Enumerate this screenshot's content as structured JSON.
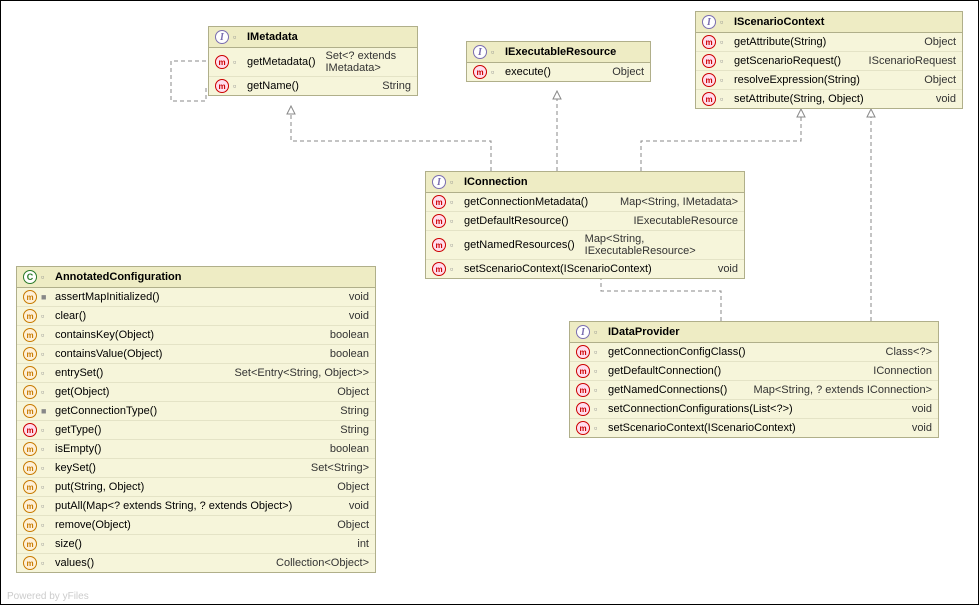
{
  "footer": "Powered by yFiles",
  "classes": {
    "imetadata": {
      "name": "IMetadata",
      "type": "interface",
      "methods": [
        {
          "k": "abs",
          "sig": "getMetadata()",
          "ret": "Set<? extends IMetadata>"
        },
        {
          "k": "abs",
          "sig": "getName()",
          "ret": "String"
        }
      ]
    },
    "iexecutableresource": {
      "name": "IExecutableResource",
      "type": "interface",
      "methods": [
        {
          "k": "abs",
          "sig": "execute()",
          "ret": "Object"
        }
      ]
    },
    "iscenariocontext": {
      "name": "IScenarioContext",
      "type": "interface",
      "methods": [
        {
          "k": "abs",
          "sig": "getAttribute(String)",
          "ret": "Object"
        },
        {
          "k": "abs",
          "sig": "getScenarioRequest()",
          "ret": "IScenarioRequest"
        },
        {
          "k": "abs",
          "sig": "resolveExpression(String)",
          "ret": "Object"
        },
        {
          "k": "abs",
          "sig": "setAttribute(String, Object)",
          "ret": "void"
        }
      ]
    },
    "iconnection": {
      "name": "IConnection",
      "type": "interface",
      "methods": [
        {
          "k": "abs",
          "sig": "getConnectionMetadata()",
          "ret": "Map<String, IMetadata>"
        },
        {
          "k": "abs",
          "sig": "getDefaultResource()",
          "ret": "IExecutableResource"
        },
        {
          "k": "abs",
          "sig": "getNamedResources()",
          "ret": "Map<String, IExecutableResource>"
        },
        {
          "k": "abs",
          "sig": "setScenarioContext(IScenarioContext)",
          "ret": "void"
        }
      ]
    },
    "idataprovider": {
      "name": "IDataProvider",
      "type": "interface",
      "methods": [
        {
          "k": "abs",
          "sig": "getConnectionConfigClass()",
          "ret": "Class<?>"
        },
        {
          "k": "abs",
          "sig": "getDefaultConnection()",
          "ret": "IConnection"
        },
        {
          "k": "abs",
          "sig": "getNamedConnections()",
          "ret": "Map<String, ? extends IConnection>"
        },
        {
          "k": "abs",
          "sig": "setConnectionConfigurations(List<?>)",
          "ret": "void"
        },
        {
          "k": "abs",
          "sig": "setScenarioContext(IScenarioContext)",
          "ret": "void"
        }
      ]
    },
    "annotatedconfiguration": {
      "name": "AnnotatedConfiguration",
      "type": "class",
      "methods": [
        {
          "k": "impl",
          "vis": "priv",
          "sig": "assertMapInitialized()",
          "ret": "void"
        },
        {
          "k": "impl",
          "vis": "pub",
          "sig": "clear()",
          "ret": "void"
        },
        {
          "k": "impl",
          "vis": "pub",
          "sig": "containsKey(Object)",
          "ret": "boolean"
        },
        {
          "k": "impl",
          "vis": "pub",
          "sig": "containsValue(Object)",
          "ret": "boolean"
        },
        {
          "k": "impl",
          "vis": "pub",
          "sig": "entrySet()",
          "ret": "Set<Entry<String, Object>>"
        },
        {
          "k": "impl",
          "vis": "pub",
          "sig": "get(Object)",
          "ret": "Object"
        },
        {
          "k": "impl",
          "vis": "priv",
          "sig": "getConnectionType()",
          "ret": "String"
        },
        {
          "k": "abs",
          "vis": "pub",
          "sig": "getType()",
          "ret": "String"
        },
        {
          "k": "impl",
          "vis": "pub",
          "sig": "isEmpty()",
          "ret": "boolean"
        },
        {
          "k": "impl",
          "vis": "pub",
          "sig": "keySet()",
          "ret": "Set<String>"
        },
        {
          "k": "impl",
          "vis": "pub",
          "sig": "put(String, Object)",
          "ret": "Object"
        },
        {
          "k": "impl",
          "vis": "pub",
          "sig": "putAll(Map<? extends String, ? extends Object>)",
          "ret": "void"
        },
        {
          "k": "impl",
          "vis": "pub",
          "sig": "remove(Object)",
          "ret": "Object"
        },
        {
          "k": "impl",
          "vis": "pub",
          "sig": "size()",
          "ret": "int"
        },
        {
          "k": "impl",
          "vis": "pub",
          "sig": "values()",
          "ret": "Collection<Object>"
        }
      ]
    }
  }
}
